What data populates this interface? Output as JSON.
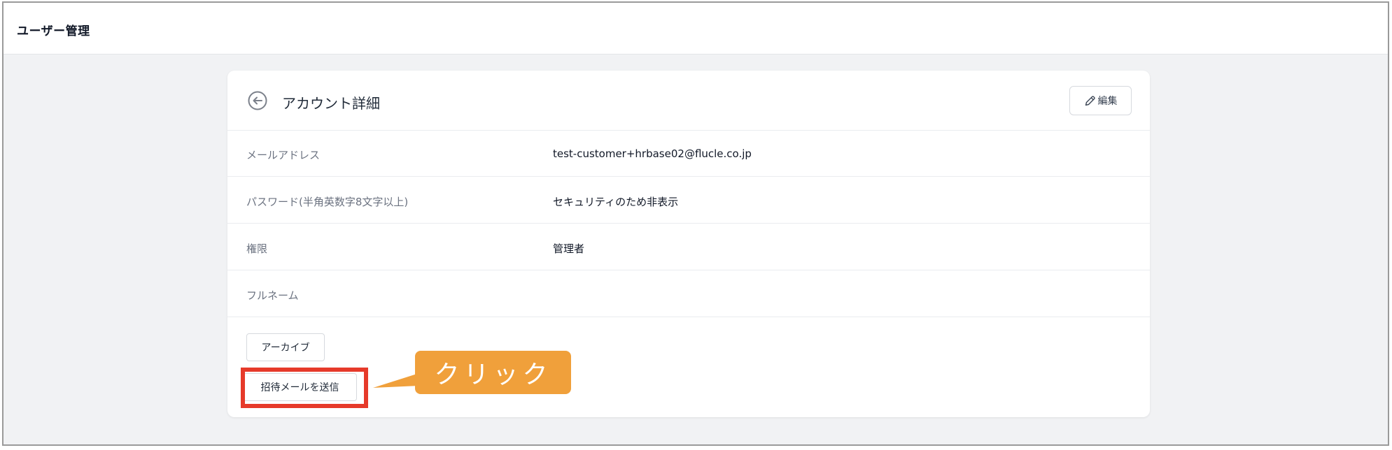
{
  "topbar": {
    "title": "ユーザー管理"
  },
  "card": {
    "title": "アカウント詳細",
    "back_icon": "circle-arrow-left-icon",
    "edit_icon": "pencil-icon",
    "edit_label": "編集"
  },
  "rows": [
    {
      "label": "メールアドレス",
      "value": "test-customer+hrbase02@flucle.co.jp"
    },
    {
      "label": "パスワード(半角英数字8文字以上)",
      "value": "セキュリティのため非表示"
    },
    {
      "label": "権限",
      "value": "管理者"
    },
    {
      "label": "フルネーム",
      "value": ""
    }
  ],
  "actions": {
    "archive_label": "アーカイブ",
    "invite_label": "招待メールを送信"
  },
  "annotation": {
    "callout_text": "クリック",
    "callout_color": "#f0a03b",
    "highlight_color": "#e63a2a"
  }
}
